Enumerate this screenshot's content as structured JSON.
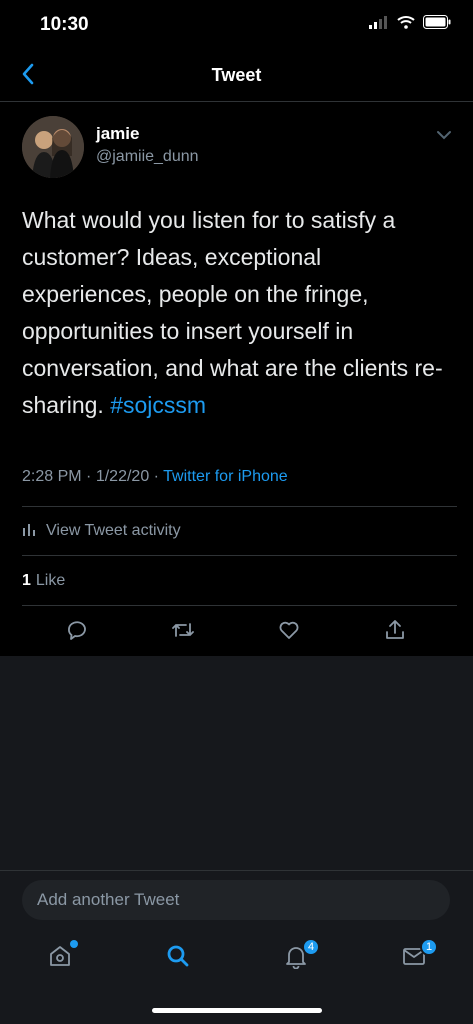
{
  "status_bar": {
    "time": "10:30"
  },
  "nav": {
    "title": "Tweet",
    "back_icon": "chevron-left-icon"
  },
  "tweet": {
    "author_name": "jamie",
    "author_handle": "@jamiie_dunn",
    "text": "What would you listen for to satisfy a customer? Ideas, exceptional experiences, people on the fringe, opportunities to insert yourself in conversation, and what are the clients re-sharing.",
    "hashtag": "#sojcssm",
    "time": "2:28 PM",
    "date": "1/22/20",
    "source": "Twitter for iPhone",
    "activity_label": "View Tweet activity",
    "like_count": "1",
    "like_label": "Like"
  },
  "compose": {
    "placeholder": "Add another Tweet"
  },
  "tab_bar": {
    "notifications_badge": "4",
    "messages_badge": "1"
  },
  "colors": {
    "accent": "#1d9bf0",
    "background": "#000000",
    "secondary_text": "#8b98a5"
  }
}
